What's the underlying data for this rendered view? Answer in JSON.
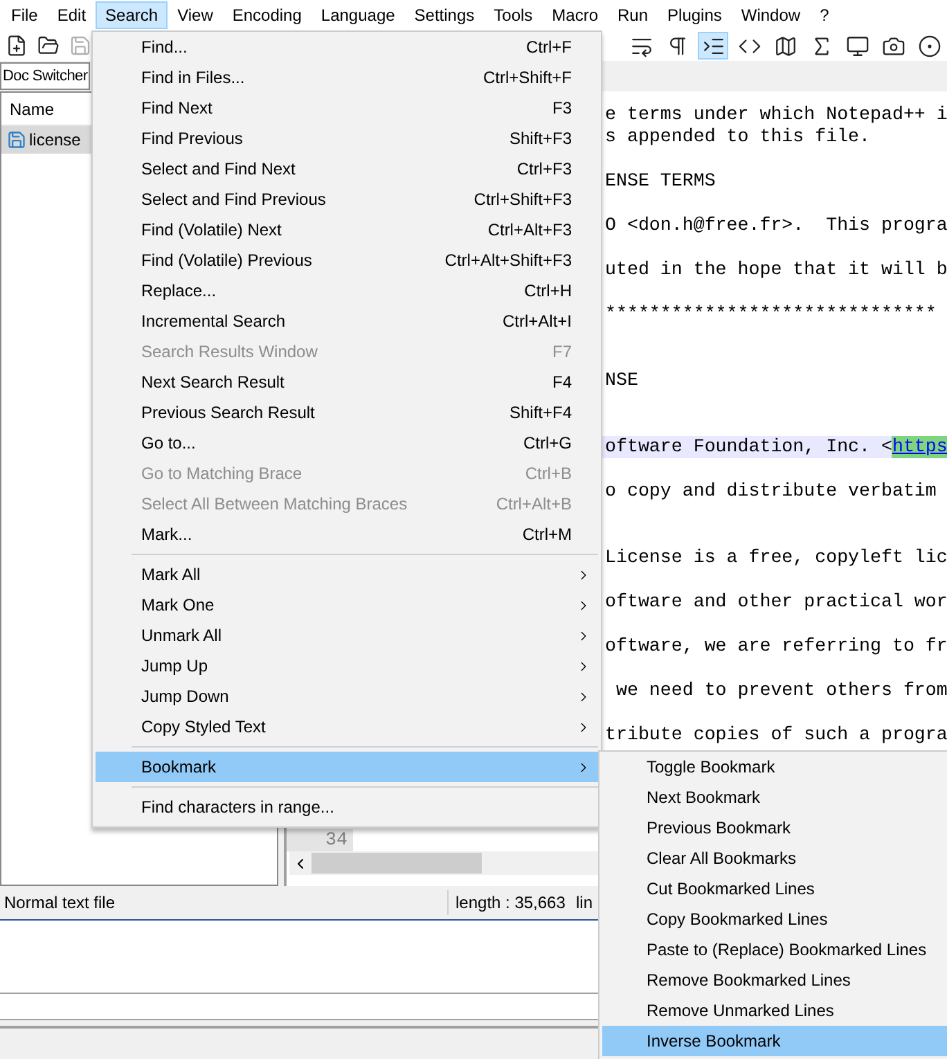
{
  "menu_bar": [
    {
      "label": "File",
      "selected": false
    },
    {
      "label": "Edit",
      "selected": false
    },
    {
      "label": "Search",
      "selected": true
    },
    {
      "label": "View",
      "selected": false
    },
    {
      "label": "Encoding",
      "selected": false
    },
    {
      "label": "Language",
      "selected": false
    },
    {
      "label": "Settings",
      "selected": false
    },
    {
      "label": "Tools",
      "selected": false
    },
    {
      "label": "Macro",
      "selected": false
    },
    {
      "label": "Run",
      "selected": false
    },
    {
      "label": "Plugins",
      "selected": false
    },
    {
      "label": "Window",
      "selected": false
    },
    {
      "label": "?",
      "selected": false
    }
  ],
  "toolbar": {
    "left": [
      {
        "kind": "new",
        "disabled": false
      },
      {
        "kind": "open",
        "disabled": false
      },
      {
        "kind": "save",
        "disabled": true
      }
    ],
    "right": [
      {
        "kind": "wrap",
        "selected": false
      },
      {
        "kind": "pilcrow",
        "selected": false
      },
      {
        "kind": "indent",
        "selected": true
      },
      {
        "kind": "code",
        "selected": false
      },
      {
        "kind": "map",
        "selected": false
      },
      {
        "kind": "function",
        "selected": false
      },
      {
        "kind": "monitor",
        "selected": false
      },
      {
        "kind": "camera",
        "selected": false
      },
      {
        "kind": "record",
        "selected": false
      }
    ]
  },
  "doc_switcher": {
    "title": "Doc Switcher",
    "column": "Name",
    "files": [
      {
        "name": "license",
        "selected": true
      }
    ]
  },
  "editor": {
    "lines": [
      {
        "kind": "text",
        "text": "e terms under which Notepad++ i"
      },
      {
        "kind": "text",
        "text": "s appended to this file."
      },
      {
        "kind": "blank"
      },
      {
        "kind": "text",
        "text": "ENSE TERMS"
      },
      {
        "kind": "blank"
      },
      {
        "kind": "text",
        "text": "O <don.h@free.fr>.  This progra"
      },
      {
        "kind": "blank"
      },
      {
        "kind": "text",
        "text": "uted in the hope that it will b"
      },
      {
        "kind": "blank"
      },
      {
        "kind": "text",
        "text": "******************************"
      },
      {
        "kind": "blank"
      },
      {
        "kind": "blank"
      },
      {
        "kind": "text",
        "text": "NSE"
      },
      {
        "kind": "blank"
      },
      {
        "kind": "blank"
      },
      {
        "kind": "link",
        "text": "oftware Foundation, Inc. <",
        "link": "https",
        "current": true
      },
      {
        "kind": "blank"
      },
      {
        "kind": "text",
        "text": "o copy and distribute verbatim"
      },
      {
        "kind": "blank"
      },
      {
        "kind": "blank"
      },
      {
        "kind": "text",
        "text": "License is a free, copyleft lic"
      },
      {
        "kind": "blank"
      },
      {
        "kind": "text",
        "text": "oftware and other practical wor"
      },
      {
        "kind": "blank"
      },
      {
        "kind": "text",
        "text": "oftware, we are referring to fr"
      },
      {
        "kind": "blank"
      },
      {
        "kind": "text",
        "text": " we need to prevent others from"
      },
      {
        "kind": "blank"
      },
      {
        "kind": "text",
        "text": "tribute copies of such a progra"
      }
    ],
    "last_line_number": "34"
  },
  "status_bar": {
    "type": "Normal text file",
    "length": "length : 35,663",
    "line": "lin"
  },
  "search_menu": [
    {
      "kind": "item",
      "label": "Find...",
      "shortcut": "Ctrl+F",
      "disabled": false,
      "selected": false
    },
    {
      "kind": "item",
      "label": "Find in Files...",
      "shortcut": "Ctrl+Shift+F",
      "disabled": false,
      "selected": false
    },
    {
      "kind": "item",
      "label": "Find Next",
      "shortcut": "F3",
      "disabled": false,
      "selected": false
    },
    {
      "kind": "item",
      "label": "Find Previous",
      "shortcut": "Shift+F3",
      "disabled": false,
      "selected": false
    },
    {
      "kind": "item",
      "label": "Select and Find Next",
      "shortcut": "Ctrl+F3",
      "disabled": false,
      "selected": false
    },
    {
      "kind": "item",
      "label": "Select and Find Previous",
      "shortcut": "Ctrl+Shift+F3",
      "disabled": false,
      "selected": false
    },
    {
      "kind": "item",
      "label": "Find (Volatile) Next",
      "shortcut": "Ctrl+Alt+F3",
      "disabled": false,
      "selected": false
    },
    {
      "kind": "item",
      "label": "Find (Volatile) Previous",
      "shortcut": "Ctrl+Alt+Shift+F3",
      "disabled": false,
      "selected": false
    },
    {
      "kind": "item",
      "label": "Replace...",
      "shortcut": "Ctrl+H",
      "disabled": false,
      "selected": false
    },
    {
      "kind": "item",
      "label": "Incremental Search",
      "shortcut": "Ctrl+Alt+I",
      "disabled": false,
      "selected": false
    },
    {
      "kind": "item",
      "label": "Search Results Window",
      "shortcut": "F7",
      "disabled": true,
      "selected": false
    },
    {
      "kind": "item",
      "label": "Next Search Result",
      "shortcut": "F4",
      "disabled": false,
      "selected": false
    },
    {
      "kind": "item",
      "label": "Previous Search Result",
      "shortcut": "Shift+F4",
      "disabled": false,
      "selected": false
    },
    {
      "kind": "item",
      "label": "Go to...",
      "shortcut": "Ctrl+G",
      "disabled": false,
      "selected": false
    },
    {
      "kind": "item",
      "label": "Go to Matching Brace",
      "shortcut": "Ctrl+B",
      "disabled": true,
      "selected": false
    },
    {
      "kind": "item",
      "label": "Select All Between Matching Braces",
      "shortcut": "Ctrl+Alt+B",
      "disabled": true,
      "selected": false
    },
    {
      "kind": "item",
      "label": "Mark...",
      "shortcut": "Ctrl+M",
      "disabled": false,
      "selected": false
    },
    {
      "kind": "separator"
    },
    {
      "kind": "submenu",
      "label": "Mark All",
      "disabled": false,
      "selected": false
    },
    {
      "kind": "submenu",
      "label": "Mark One",
      "disabled": false,
      "selected": false
    },
    {
      "kind": "submenu",
      "label": "Unmark All",
      "disabled": false,
      "selected": false
    },
    {
      "kind": "submenu",
      "label": "Jump Up",
      "disabled": false,
      "selected": false
    },
    {
      "kind": "submenu",
      "label": "Jump Down",
      "disabled": false,
      "selected": false
    },
    {
      "kind": "submenu",
      "label": "Copy Styled Text",
      "disabled": false,
      "selected": false
    },
    {
      "kind": "separator"
    },
    {
      "kind": "submenu",
      "label": "Bookmark",
      "disabled": false,
      "selected": true
    },
    {
      "kind": "separator"
    },
    {
      "kind": "item",
      "label": "Find characters in range...",
      "disabled": false,
      "selected": false
    }
  ],
  "bookmark_menu": [
    {
      "kind": "item",
      "label": "Toggle Bookmark",
      "disabled": false,
      "selected": false
    },
    {
      "kind": "item",
      "label": "Next Bookmark",
      "disabled": false,
      "selected": false
    },
    {
      "kind": "item",
      "label": "Previous Bookmark",
      "disabled": false,
      "selected": false
    },
    {
      "kind": "item",
      "label": "Clear All Bookmarks",
      "disabled": false,
      "selected": false
    },
    {
      "kind": "item",
      "label": "Cut Bookmarked Lines",
      "disabled": false,
      "selected": false
    },
    {
      "kind": "item",
      "label": "Copy Bookmarked Lines",
      "disabled": false,
      "selected": false
    },
    {
      "kind": "item",
      "label": "Paste to (Replace) Bookmarked Lines",
      "disabled": false,
      "selected": false
    },
    {
      "kind": "item",
      "label": "Remove Bookmarked Lines",
      "disabled": false,
      "selected": false
    },
    {
      "kind": "item",
      "label": "Remove Unmarked Lines",
      "disabled": false,
      "selected": false
    },
    {
      "kind": "item",
      "label": "Inverse Bookmark",
      "disabled": false,
      "selected": true
    }
  ]
}
